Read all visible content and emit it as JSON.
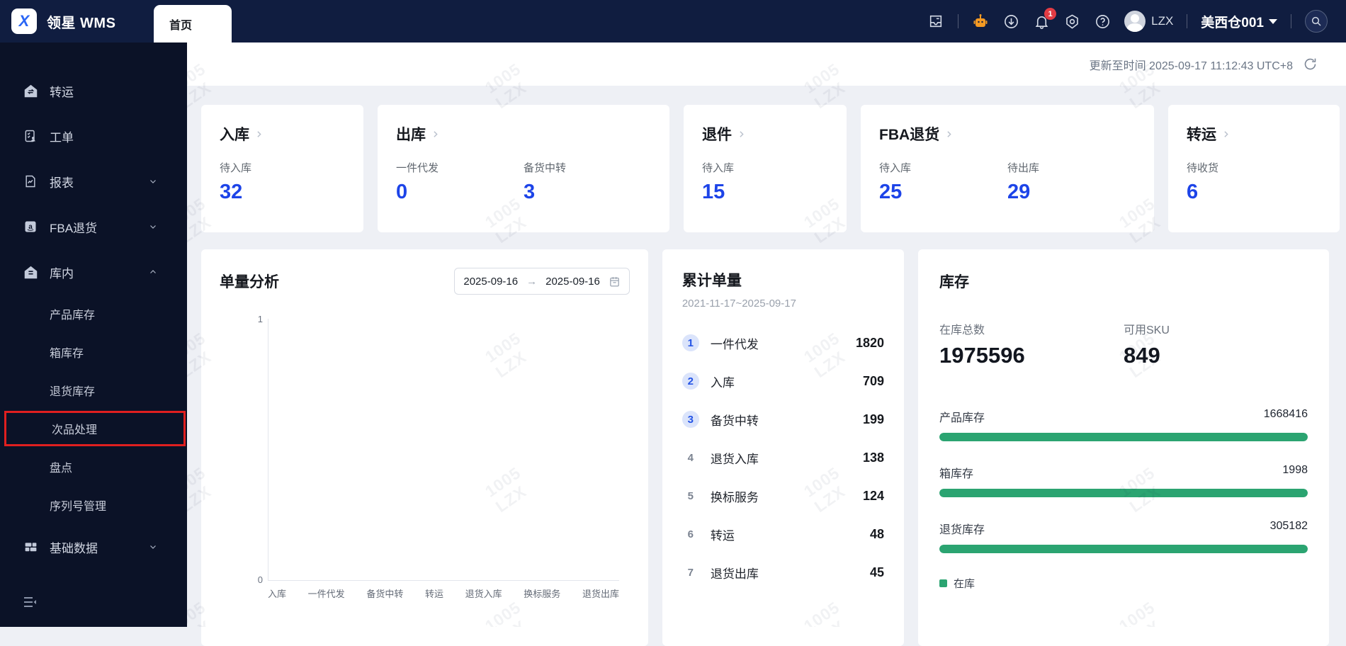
{
  "app": {
    "title": "领星 WMS"
  },
  "tabs": {
    "home": "首页"
  },
  "topbar": {
    "notification_count": "1",
    "user_name": "LZX",
    "warehouse": "美西仓001",
    "icons": [
      "inbox-icon",
      "robot-icon",
      "download-icon",
      "bell-icon",
      "settings-icon",
      "help-icon",
      "search-icon"
    ]
  },
  "sidebar": {
    "items": [
      {
        "label": "转运"
      },
      {
        "label": "工单"
      },
      {
        "label": "报表"
      },
      {
        "label": "FBA退货"
      },
      {
        "label": "库内"
      },
      {
        "label": "产品库存"
      },
      {
        "label": "箱库存"
      },
      {
        "label": "退货库存"
      },
      {
        "label": "次品处理"
      },
      {
        "label": "盘点"
      },
      {
        "label": "序列号管理"
      },
      {
        "label": "基础数据"
      }
    ]
  },
  "header": {
    "updated_label": "更新至时间",
    "updated_time": "2025-09-17 11:12:43 UTC+8"
  },
  "summary_cards": {
    "inbound": {
      "title": "入库",
      "stat1_label": "待入库",
      "stat1_value": "32"
    },
    "outbound": {
      "title": "出库",
      "stat1_label": "一件代发",
      "stat1_value": "0",
      "stat2_label": "备货中转",
      "stat2_value": "3"
    },
    "returns": {
      "title": "退件",
      "stat1_label": "待入库",
      "stat1_value": "15"
    },
    "fba_returns": {
      "title": "FBA退货",
      "stat1_label": "待入库",
      "stat1_value": "25",
      "stat2_label": "待出库",
      "stat2_value": "29"
    },
    "transfer": {
      "title": "转运",
      "stat1_label": "待收货",
      "stat1_value": "6"
    }
  },
  "volume_analysis": {
    "title": "单量分析",
    "date_from": "2025-09-16",
    "date_to": "2025-09-16",
    "chart_data": {
      "type": "bar",
      "title": "单量分析",
      "categories": [
        "入库",
        "一件代发",
        "备货中转",
        "转运",
        "退货入库",
        "换标服务",
        "退货出库"
      ],
      "values": [
        0,
        0,
        0,
        0,
        0,
        0,
        0
      ],
      "xlabel": "",
      "ylabel": "",
      "ylim": [
        0,
        1
      ],
      "yticks": [
        0,
        1
      ],
      "grid": false,
      "legend_position": "none"
    }
  },
  "cumulative": {
    "title": "累计单量",
    "range": "2021-11-17~2025-09-17",
    "items": [
      {
        "rank": "1",
        "label": "一件代发",
        "value": "1820"
      },
      {
        "rank": "2",
        "label": "入库",
        "value": "709"
      },
      {
        "rank": "3",
        "label": "备货中转",
        "value": "199"
      },
      {
        "rank": "4",
        "label": "退货入库",
        "value": "138"
      },
      {
        "rank": "5",
        "label": "换标服务",
        "value": "124"
      },
      {
        "rank": "6",
        "label": "转运",
        "value": "48"
      },
      {
        "rank": "7",
        "label": "退货出库",
        "value": "45"
      }
    ]
  },
  "inventory": {
    "title": "库存",
    "total_label": "在库总数",
    "total_value": "1975596",
    "sku_label": "可用SKU",
    "sku_value": "849",
    "bars": [
      {
        "label": "产品库存",
        "value": "1668416",
        "pct": 100
      },
      {
        "label": "箱库存",
        "value": "1998",
        "pct": 100
      },
      {
        "label": "退货库存",
        "value": "305182",
        "pct": 100
      }
    ],
    "legend": "在库"
  },
  "watermark": {
    "line1": "1005",
    "line2": "LZX"
  },
  "colors": {
    "accent_blue": "#1d44e8",
    "bar_green": "#2ba471",
    "badge_red": "#e23c44",
    "highlight_red": "#e01f1f",
    "topbar_navy": "#101d40",
    "sidebar_navy": "#0b1227"
  }
}
